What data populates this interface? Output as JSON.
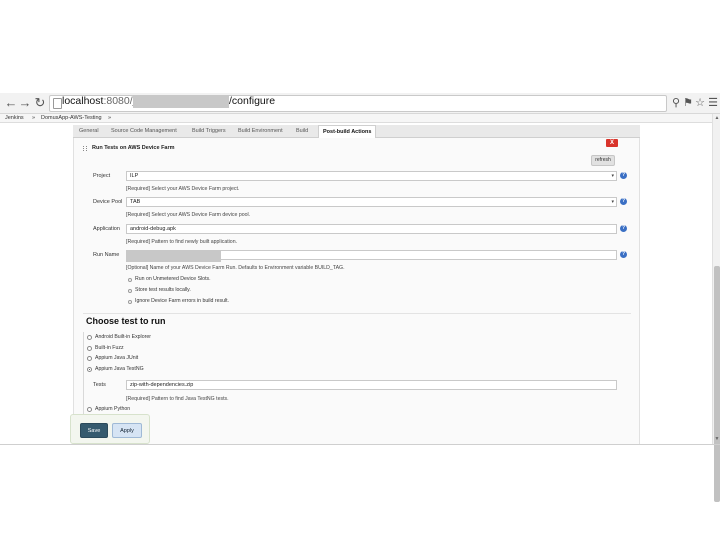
{
  "browser": {
    "url_host": "localhost",
    "url_port_path": ":8080/job/",
    "url_suffix": "/configure",
    "back_icon": "arrow-left-icon",
    "forward_icon": "arrow-right-icon",
    "reload_icon": "reload-icon",
    "zoom_icon": "magnifier-icon",
    "ext_icon": "key-icon",
    "star_icon": "star-icon",
    "menu_icon": "hamburger-icon"
  },
  "breadcrumbs": [
    "Jenkins",
    "DomusApp-AWS-Testing"
  ],
  "breadcrumb_sep": "»",
  "tabs": [
    "General",
    "Source Code Management",
    "Build Triggers",
    "Build Environment",
    "Build",
    "Post-build Actions"
  ],
  "active_tab": "Post-build Actions",
  "section": {
    "title": "Run Tests on AWS Device Farm",
    "close_label": "X",
    "refresh_label": "refresh"
  },
  "fields": {
    "project": {
      "label": "Project",
      "value": "ILP",
      "hint": "[Required] Select your AWS Device Farm project."
    },
    "device_pool": {
      "label": "Device Pool",
      "value": "TAB",
      "hint": "[Required] Select your AWS Device Farm device pool."
    },
    "application": {
      "label": "Application",
      "value": "android-debug.apk",
      "hint": "[Required] Pattern to find newly built application."
    },
    "run_name": {
      "label": "Run Name",
      "value": "",
      "hint": "[Optional] Name of your AWS Device Farm Run. Defaults to Environment variable BUILD_TAG."
    }
  },
  "checkboxes": [
    "Run on Unmetered Device Slots.",
    "Store test results locally.",
    "Ignore Device Farm errors in build result."
  ],
  "choose_test": {
    "heading": "Choose test to run",
    "options": [
      "Android Built-in Explorer",
      "Built-in Fuzz",
      "Appium Java JUnit",
      "Appium Java TestNG"
    ],
    "selected_index": 3,
    "tests": {
      "label": "Tests",
      "value": "zip-with-dependencies.zip",
      "hint": "[Required] Pattern to find Java TestNG tests."
    },
    "next_option": "Appium Python"
  },
  "buttons": {
    "save": "Save",
    "apply": "Apply"
  },
  "colors": {
    "save_bg": "#355a6e",
    "apply_bg": "#d6e4f4",
    "close_bg": "#d9342b",
    "help_bg": "#3a6fc4"
  }
}
